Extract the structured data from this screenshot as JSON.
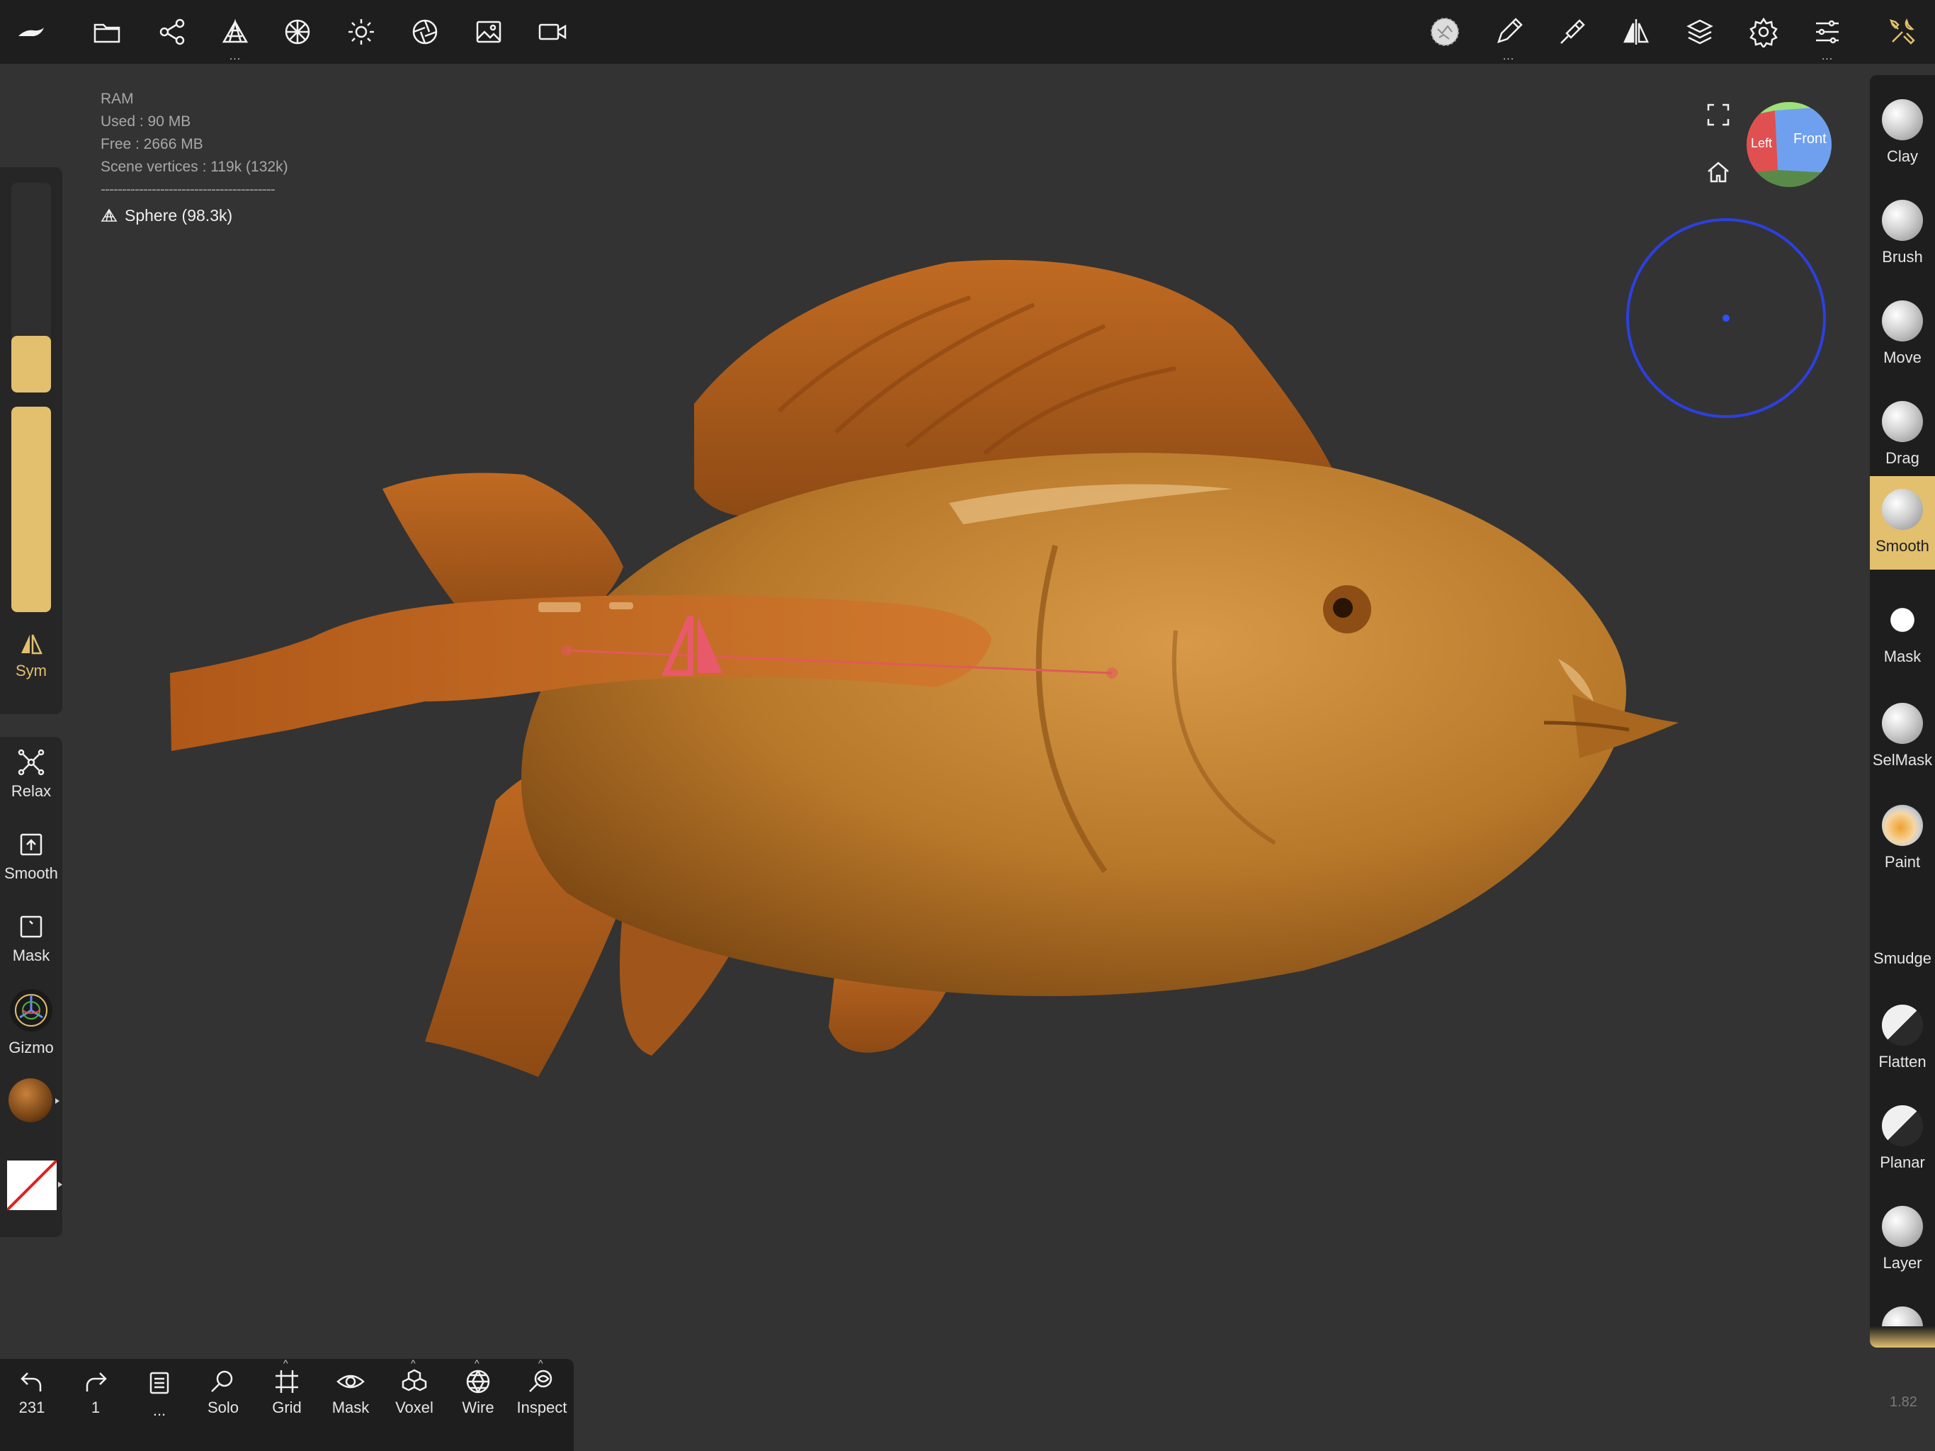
{
  "ram": {
    "title": "RAM",
    "used": "Used : 90 MB",
    "free": "Free : 2666 MB",
    "vertices": "Scene vertices : 119k (132k)",
    "separator": "-----------------------------------------",
    "mesh": "Sphere (98.3k)"
  },
  "left": {
    "sym_label": "Sym",
    "relax_label": "Relax",
    "smooth_label": "Smooth",
    "mask_label": "Mask",
    "gizmo_label": "Gizmo",
    "radius_level": 0.27,
    "intensity_level": 1.0
  },
  "right_tools": [
    {
      "label": "Clay"
    },
    {
      "label": "Brush"
    },
    {
      "label": "Move"
    },
    {
      "label": "Drag"
    },
    {
      "label": "Smooth"
    },
    {
      "label": "Mask"
    },
    {
      "label": "SelMask"
    },
    {
      "label": "Paint"
    },
    {
      "label": "Smudge"
    },
    {
      "label": "Flatten"
    },
    {
      "label": "Planar"
    },
    {
      "label": "Layer"
    }
  ],
  "active_tool": "Smooth",
  "bottom": {
    "undo_count": "231",
    "redo_count": "1",
    "more": "...",
    "solo": "Solo",
    "grid": "Grid",
    "mask": "Mask",
    "voxel": "Voxel",
    "wire": "Wire",
    "inspect": "Inspect"
  },
  "navcube": {
    "left": "Left",
    "front": "Front"
  },
  "version": "1.82",
  "colors": {
    "accent": "#e2c06e",
    "fish": "#b8702a",
    "background": "#333333"
  }
}
